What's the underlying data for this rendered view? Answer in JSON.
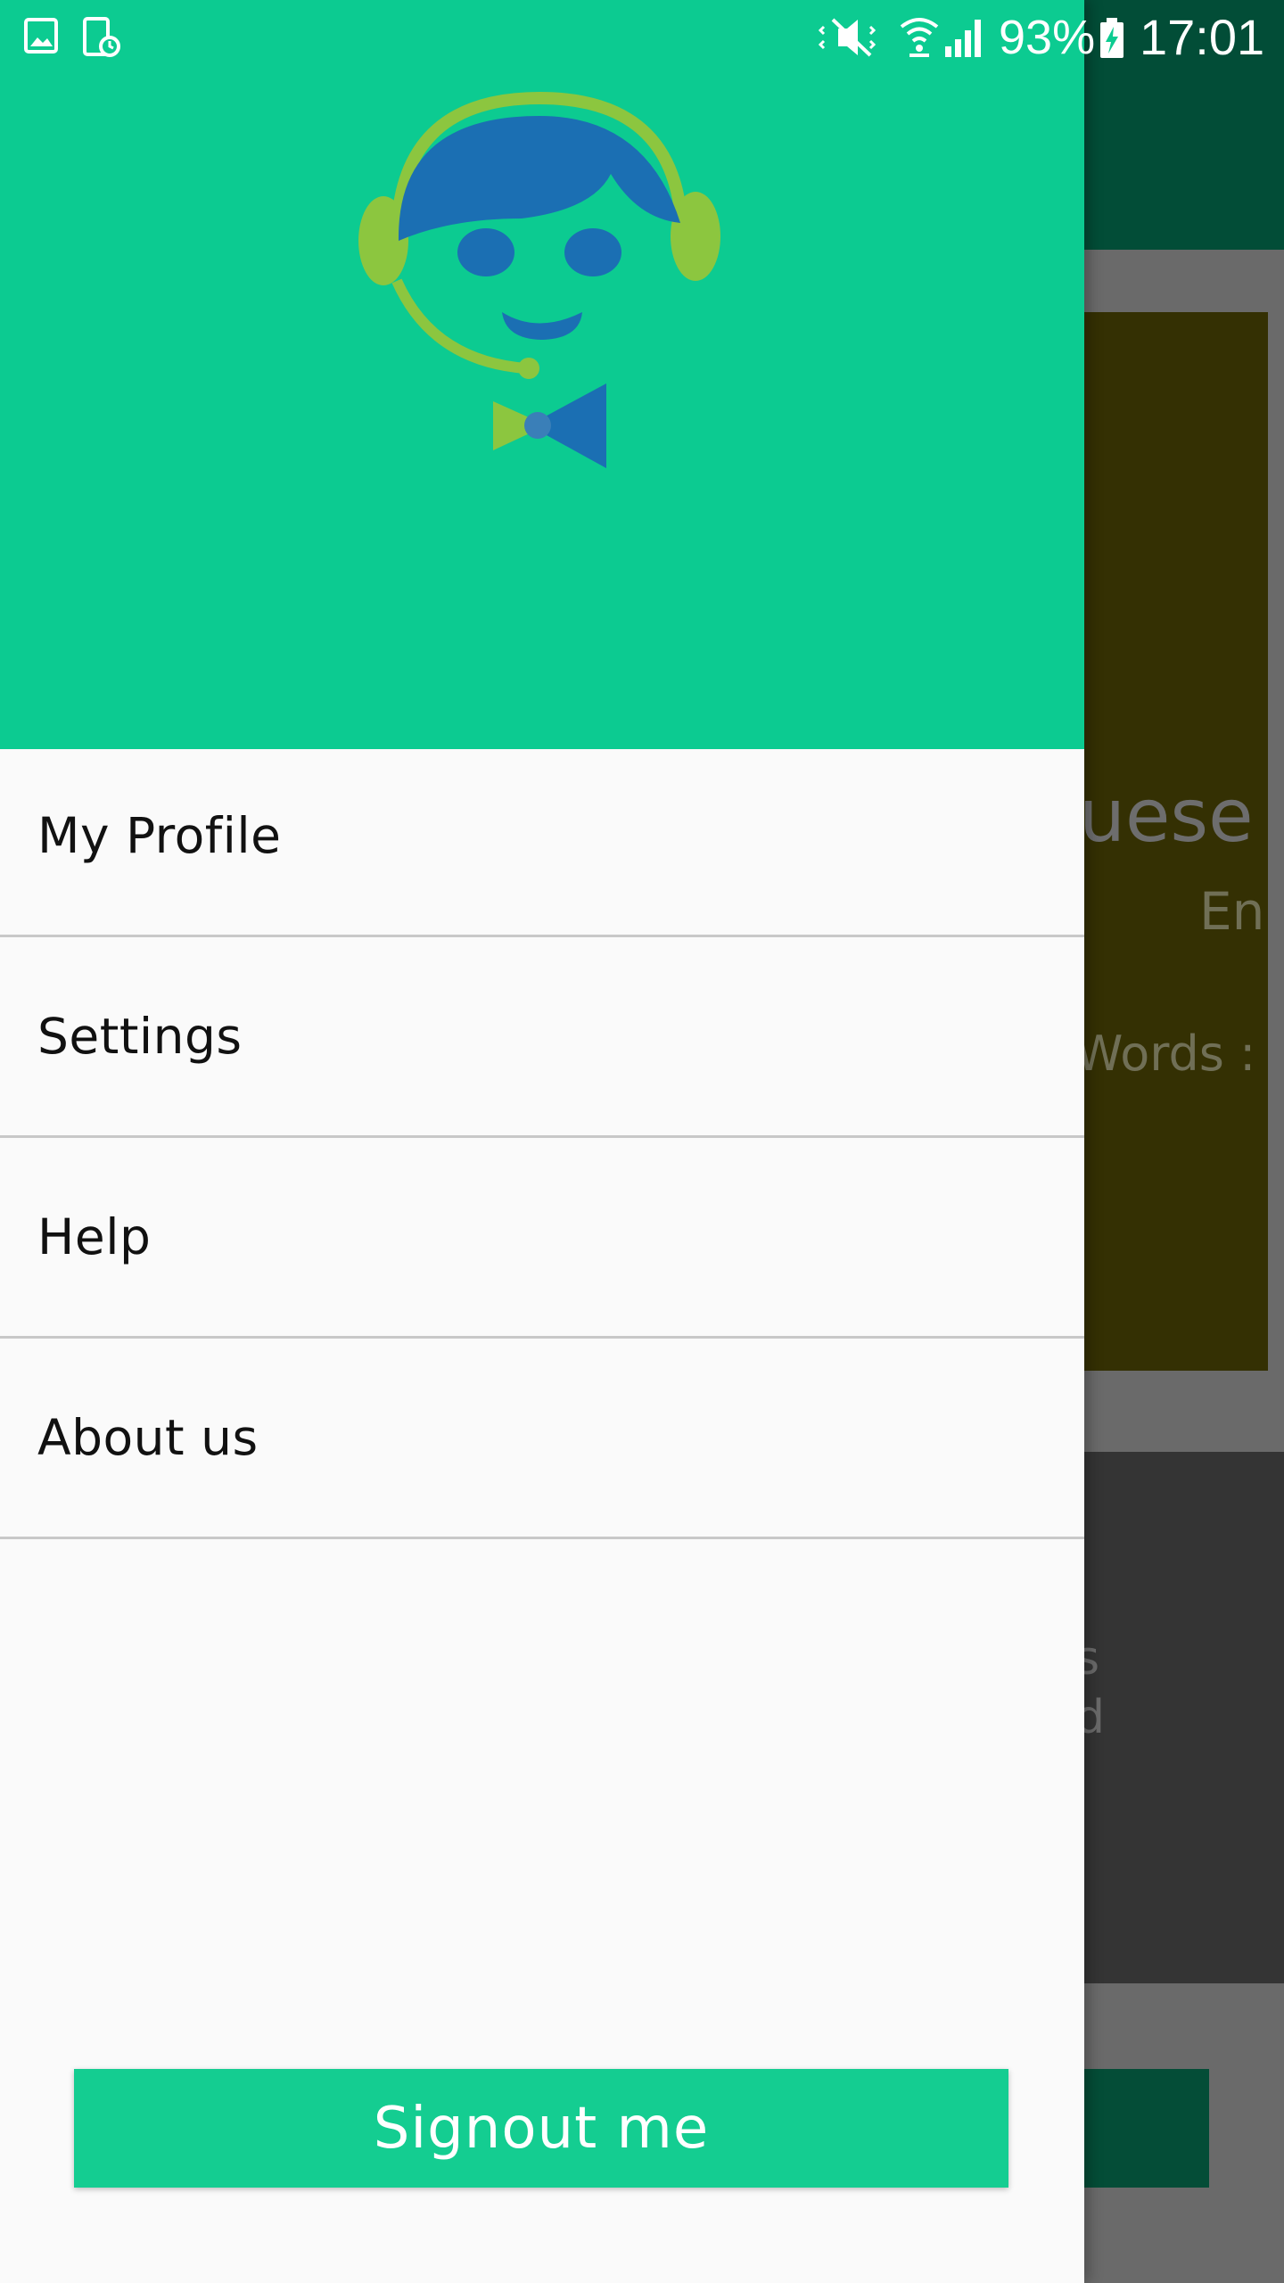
{
  "status_bar": {
    "battery_percent": "93%",
    "time": "17:01",
    "icons": [
      "gallery-icon",
      "screenshot-icon",
      "mute-icon",
      "wifi-icon",
      "signal-icon",
      "battery-charging-icon"
    ]
  },
  "drawer": {
    "header_color": "#0ccb91",
    "logo": "support-agent-logo",
    "menu_items": [
      {
        "label": "My Profile"
      },
      {
        "label": "Settings"
      },
      {
        "label": "Help"
      },
      {
        "label": "About us"
      }
    ],
    "signout_label": "Signout me",
    "signout_color": "#14cd91"
  },
  "background_app": {
    "text_1": "uese",
    "text_2": "En",
    "text_3": "Words :",
    "text_4": "s",
    "text_5": "d"
  }
}
